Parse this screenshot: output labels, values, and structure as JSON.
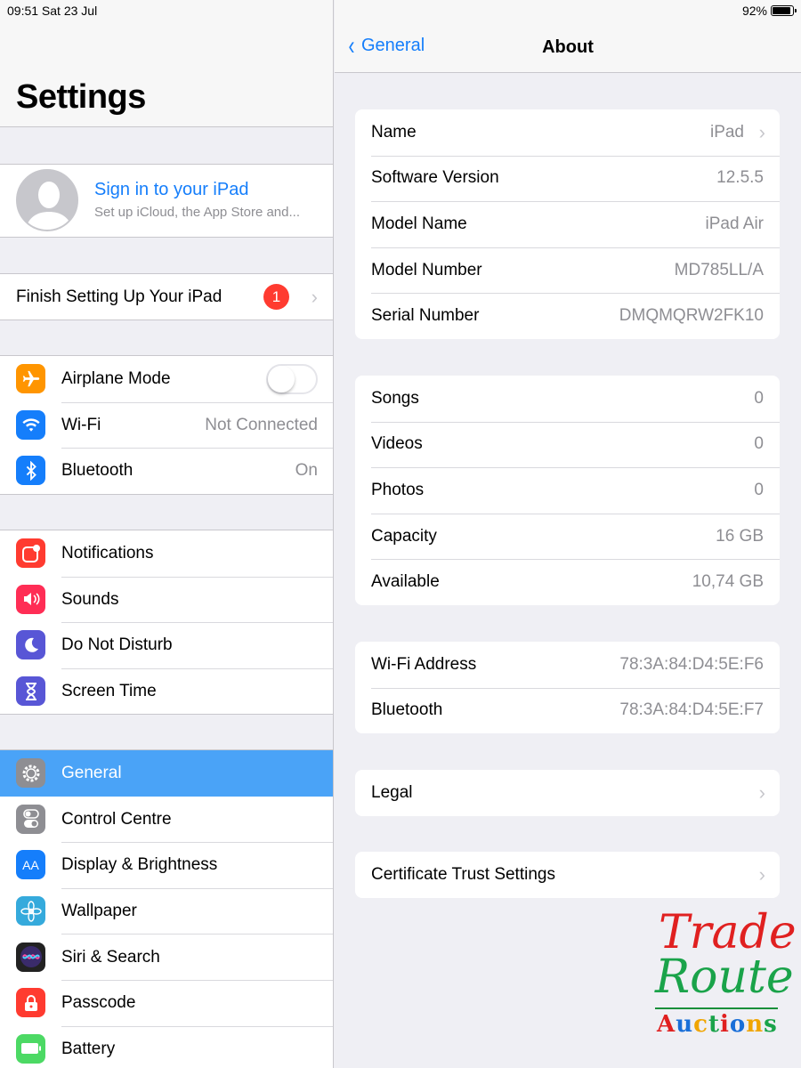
{
  "status_bar": {
    "time": "09:51  Sat 23 Jul",
    "battery": "92%",
    "battery_level": 0.92
  },
  "sidebar": {
    "title": "Settings",
    "account": {
      "title": "Sign in to your iPad",
      "subtitle": "Set up iCloud, the App Store and..."
    },
    "finish_setup": {
      "label": "Finish Setting Up Your iPad",
      "badge": "1"
    },
    "group1": [
      {
        "label": "Airplane Mode",
        "value": "",
        "icon": "airplane-icon",
        "color": "#ff9500"
      },
      {
        "label": "Wi-Fi",
        "value": "Not Connected",
        "icon": "wifi-icon",
        "color": "#157efb"
      },
      {
        "label": "Bluetooth",
        "value": "On",
        "icon": "bluetooth-icon",
        "color": "#157efb"
      }
    ],
    "group2": [
      {
        "label": "Notifications",
        "icon": "notifications-icon",
        "color": "#ff3b30"
      },
      {
        "label": "Sounds",
        "icon": "speaker-icon",
        "color": "#ff2d55"
      },
      {
        "label": "Do Not Disturb",
        "icon": "moon-icon",
        "color": "#5856d6"
      },
      {
        "label": "Screen Time",
        "icon": "hourglass-icon",
        "color": "#5856d6"
      }
    ],
    "group3": [
      {
        "label": "General",
        "icon": "gear-icon",
        "color": "#8e8e93",
        "selected": true
      },
      {
        "label": "Control Centre",
        "icon": "toggles-icon",
        "color": "#8e8e93"
      },
      {
        "label": "Display & Brightness",
        "icon": "text-size-icon",
        "color": "#157efb",
        "glyph": "AA"
      },
      {
        "label": "Wallpaper",
        "icon": "flower-icon",
        "color": "#35aadc"
      },
      {
        "label": "Siri & Search",
        "icon": "siri-icon",
        "color": "#222222"
      },
      {
        "label": "Passcode",
        "icon": "lock-icon",
        "color": "#ff3b30"
      },
      {
        "label": "Battery",
        "icon": "battery-icon",
        "color": "#4cd964"
      }
    ]
  },
  "detail": {
    "back_label": "General",
    "title": "About",
    "section1": [
      {
        "label": "Name",
        "value": "iPad",
        "chevron": true
      },
      {
        "label": "Software Version",
        "value": "12.5.5"
      },
      {
        "label": "Model Name",
        "value": "iPad Air"
      },
      {
        "label": "Model Number",
        "value": "MD785LL/A"
      },
      {
        "label": "Serial Number",
        "value": "DMQMQRW2FK10"
      }
    ],
    "section2": [
      {
        "label": "Songs",
        "value": "0"
      },
      {
        "label": "Videos",
        "value": "0"
      },
      {
        "label": "Photos",
        "value": "0"
      },
      {
        "label": "Capacity",
        "value": "16 GB"
      },
      {
        "label": "Available",
        "value": "10,74 GB"
      }
    ],
    "section3": [
      {
        "label": "Wi-Fi Address",
        "value": "78:3A:84:D4:5E:F6"
      },
      {
        "label": "Bluetooth",
        "value": "78:3A:84:D4:5E:F7"
      }
    ],
    "section4": [
      {
        "label": "Legal",
        "chevron": true
      }
    ],
    "section5": [
      {
        "label": "Certificate Trust Settings",
        "chevron": true
      }
    ]
  },
  "watermark": {
    "line1": "Trade",
    "line2": "Route",
    "line3": "Auctions"
  }
}
